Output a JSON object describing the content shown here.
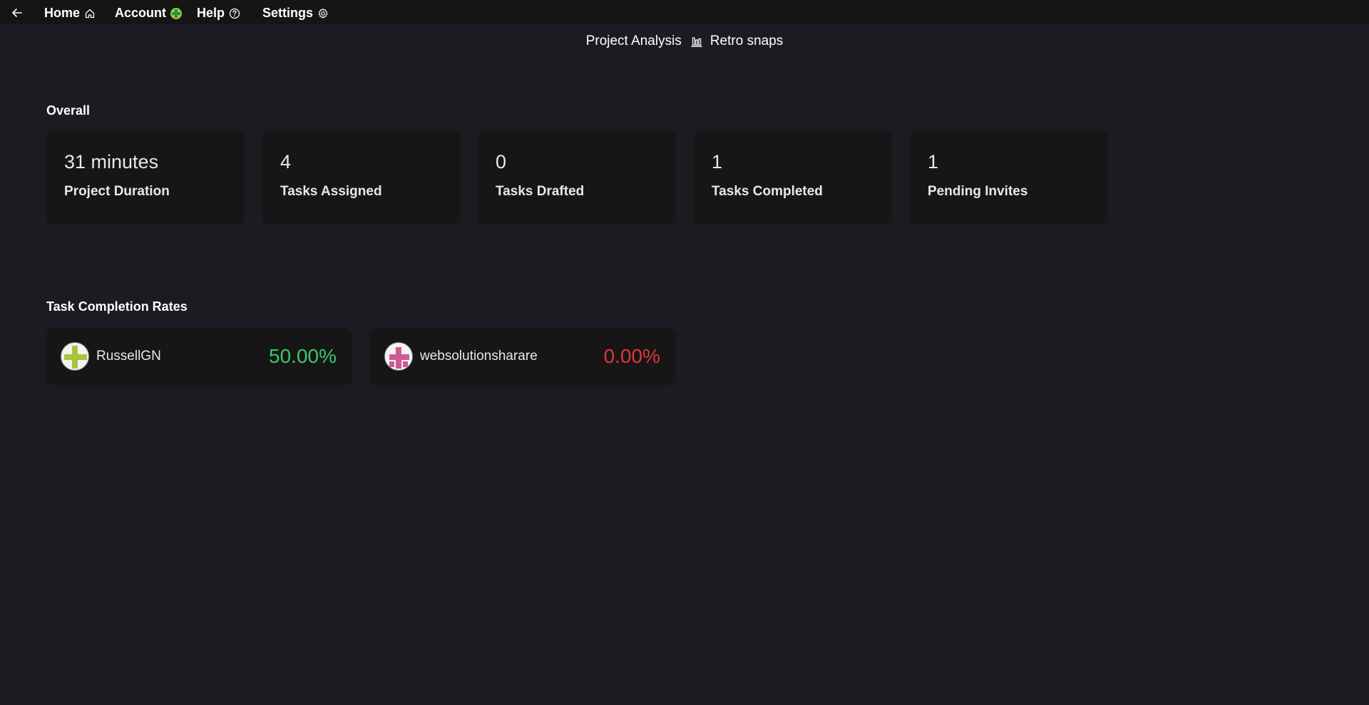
{
  "nav": {
    "home_label": "Home",
    "account_label": "Account",
    "help_label": "Help",
    "settings_label": "Settings",
    "icons": {
      "back": "arrow-left-icon",
      "home": "home-icon",
      "account": "account-avatar-icon",
      "help": "question-circle-icon",
      "settings": "gear-icon"
    }
  },
  "subnav": {
    "project_analysis_label": "Project Analysis",
    "retro_snaps_label": "Retro snaps",
    "icon": "bar-chart-icon"
  },
  "overall": {
    "title": "Overall",
    "cards": [
      {
        "value": "31 minutes",
        "label": "Project Duration"
      },
      {
        "value": "4",
        "label": "Tasks Assigned"
      },
      {
        "value": "0",
        "label": "Tasks Drafted"
      },
      {
        "value": "1",
        "label": "Tasks Completed"
      },
      {
        "value": "1",
        "label": "Pending Invites"
      }
    ]
  },
  "completion_rates": {
    "title": "Task Completion Rates",
    "users": [
      {
        "name": "RussellGN",
        "rate": "50.00%",
        "rate_color": "#3ac86a",
        "avatar_color": "#a7c53b"
      },
      {
        "name": "websolutionsharare",
        "rate": "0.00%",
        "rate_color": "#e0353f",
        "avatar_color": "#d05896"
      }
    ]
  },
  "colors": {
    "background": "#1d1b22",
    "topbar": "#151515",
    "card": "#161616",
    "positive": "#3ac86a",
    "negative": "#e0353f"
  }
}
